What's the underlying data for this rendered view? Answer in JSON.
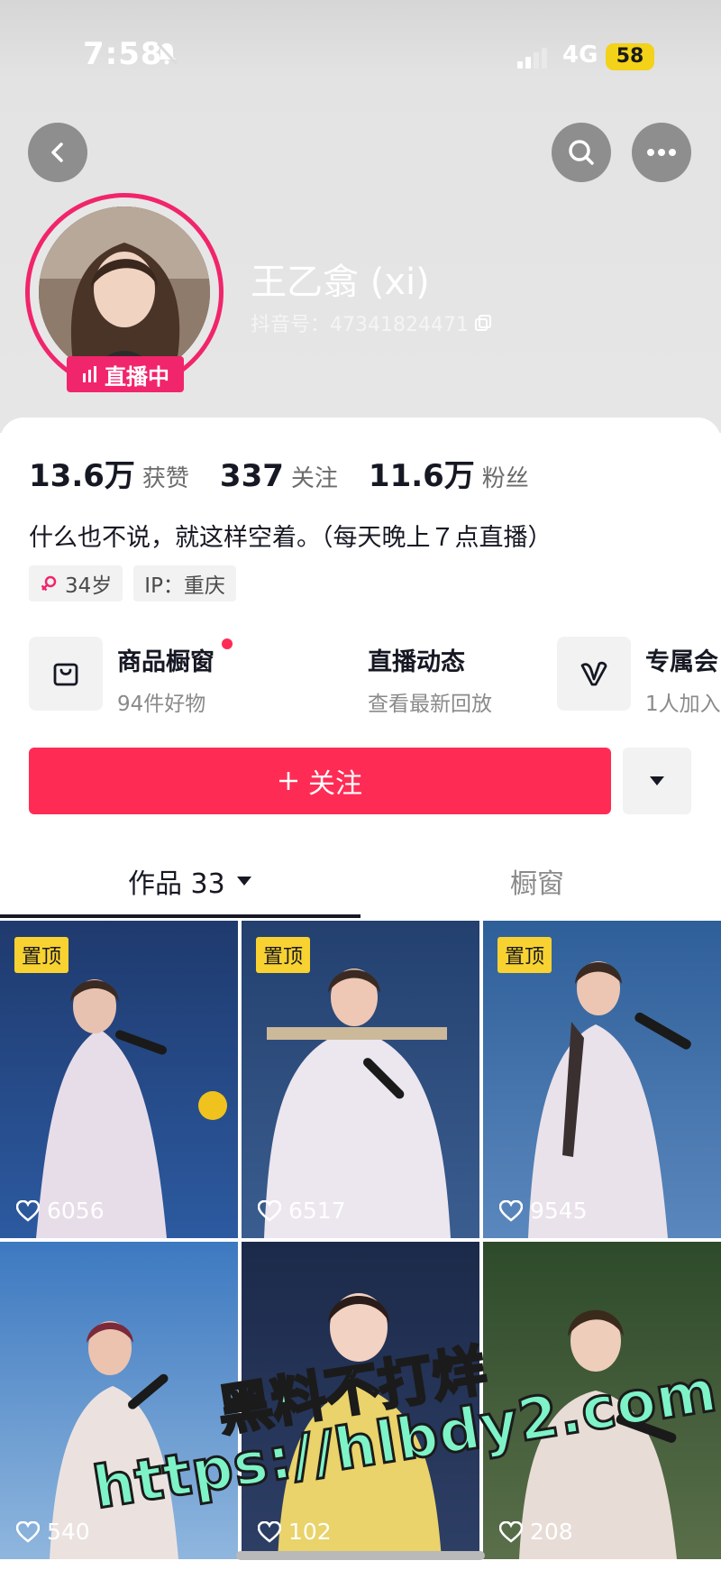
{
  "status_bar": {
    "time": "7:58",
    "network": "4G",
    "battery": "58"
  },
  "profile": {
    "name": "王乙翕 (xi)",
    "douyin_id": "抖音号：47341824471",
    "live_badge": "直播中"
  },
  "stats": [
    {
      "value": "13.6万",
      "label": "获赞"
    },
    {
      "value": "337",
      "label": "关注"
    },
    {
      "value": "11.6万",
      "label": "粉丝"
    }
  ],
  "bio": "什么也不说，就这样空着。（每天晚上７点直播）",
  "tags": {
    "age": "34岁",
    "ip": "IP：重庆"
  },
  "shortcuts": [
    {
      "title": "商品橱窗",
      "sub": "94件好物"
    },
    {
      "title": "直播动态",
      "sub": "查看最新回放"
    },
    {
      "title": "专属会",
      "sub": "1人加入"
    }
  ],
  "follow_label": "关注",
  "tabs": {
    "works": "作品 33",
    "window": "橱窗"
  },
  "pin_label": "置顶",
  "videos": [
    {
      "likes": "6056"
    },
    {
      "likes": "6517"
    },
    {
      "likes": "9545"
    },
    {
      "likes": "540"
    },
    {
      "likes": "102"
    },
    {
      "likes": "208"
    }
  ],
  "watermark": {
    "line1": "黑料不打烊",
    "line2": "https://hlbdy2.com"
  },
  "colors": {
    "accent": "#fe2c55",
    "live": "#f1256b",
    "pin": "#f8d231"
  }
}
